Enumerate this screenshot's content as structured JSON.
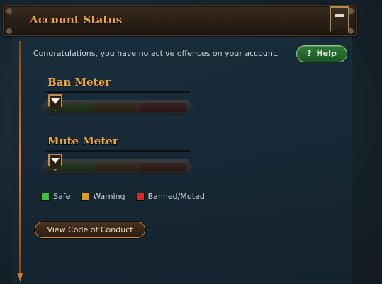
{
  "header": {
    "title": "Account Status",
    "collapse_icon": "minus-icon"
  },
  "status": {
    "message": "Congratulations, you have no active offences on your account."
  },
  "help_button": {
    "icon": "question-icon",
    "icon_glyph": "?",
    "label": "Help"
  },
  "meters": {
    "ban": {
      "label": "Ban Meter",
      "level": 0
    },
    "mute": {
      "label": "Mute Meter",
      "level": 0
    }
  },
  "legend": {
    "items": [
      {
        "label": "Safe",
        "color": "#3fbf3f"
      },
      {
        "label": "Warning",
        "color": "#e09a22"
      },
      {
        "label": "Banned/Muted",
        "color": "#d02a2a"
      }
    ]
  },
  "code_button": {
    "label": "View Code of Conduct"
  },
  "colors": {
    "accent_orange": "#f0a742",
    "help_green": "#2e7a3a",
    "panel_bg": "#1b2f3c"
  }
}
